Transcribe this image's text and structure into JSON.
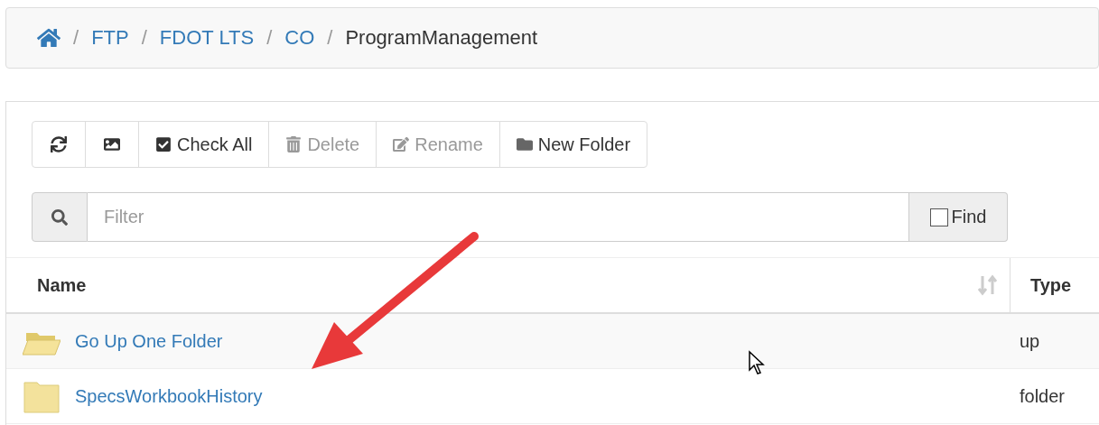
{
  "breadcrumb": {
    "items": [
      {
        "separator": "/",
        "label": "FTP"
      },
      {
        "separator": "/",
        "label": "FDOT LTS"
      },
      {
        "separator": "/",
        "label": "CO"
      }
    ],
    "current_separator": "/",
    "current": "ProgramManagement"
  },
  "toolbar": [
    {
      "kind": "refresh",
      "disabled": false
    },
    {
      "kind": "image",
      "disabled": false
    },
    {
      "kind": "check",
      "label": "Check All",
      "disabled": false
    },
    {
      "kind": "delete",
      "label": "Delete",
      "disabled": true
    },
    {
      "kind": "rename",
      "label": "Rename",
      "disabled": true
    },
    {
      "kind": "folder",
      "label": "New Folder",
      "disabled": false
    }
  ],
  "filter": {
    "placeholder": "Filter",
    "find_label": "Find",
    "find_checked": false
  },
  "table": {
    "columns": [
      "Name",
      "Type"
    ],
    "rows": [
      {
        "kind": "up",
        "name": "Go Up One Folder",
        "type": "up"
      },
      {
        "kind": "folder",
        "name": "SpecsWorkbookHistory",
        "type": "folder"
      }
    ]
  }
}
